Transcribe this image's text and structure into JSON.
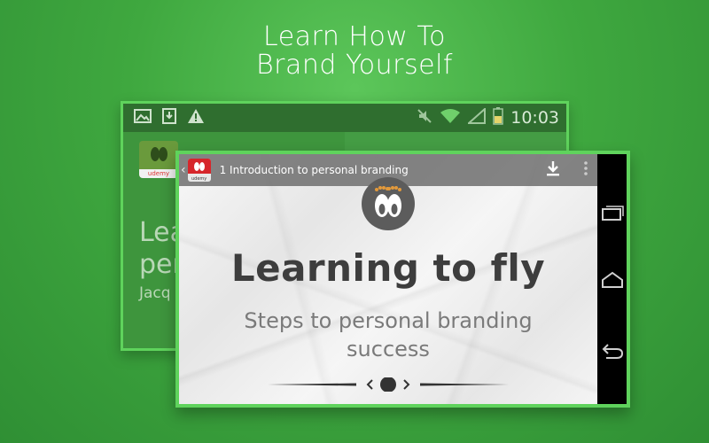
{
  "headline": {
    "line1": "Learn How To",
    "line2": "Brand Yourself"
  },
  "back_screen": {
    "clock": "10:03",
    "app_icon_label": "udemy",
    "title_line1": "Lea",
    "title_line2": "per",
    "author": "Jacq"
  },
  "front_screen": {
    "lecture_title": "1  Introduction to personal branding",
    "badge_label": "udemy",
    "slide_title": "Learning to fly",
    "slide_subtitle_line1": "Steps to personal branding",
    "slide_subtitle_line2": "success"
  },
  "colors": {
    "background": "#3fa83f",
    "frame": "#5fd35c",
    "appbar": "#6e6e6e",
    "slide_title": "#3d3d3d"
  },
  "icons": [
    "image-icon",
    "download-icon",
    "warning-icon",
    "mute-icon",
    "wifi-icon",
    "signal-icon",
    "battery-icon",
    "back-chevron-icon",
    "overflow-menu-icon",
    "recent-apps-icon",
    "home-icon",
    "back-icon",
    "feet-logo-icon"
  ]
}
